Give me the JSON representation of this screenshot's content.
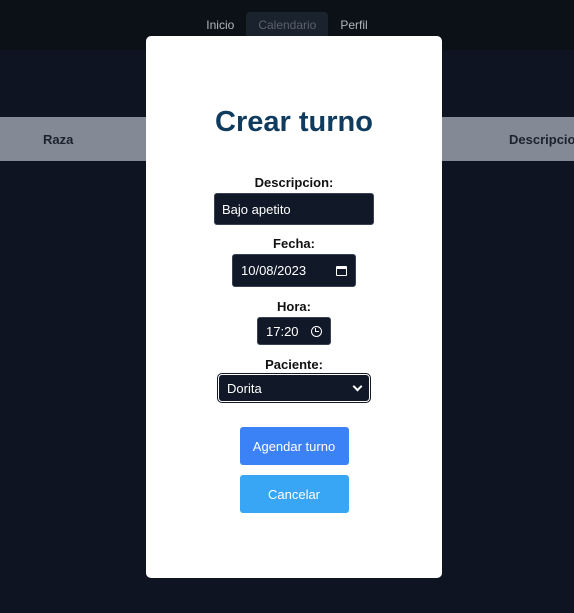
{
  "nav": {
    "items": [
      {
        "label": "Inicio",
        "active": false
      },
      {
        "label": "Calendario",
        "active": true
      },
      {
        "label": "Perfil",
        "active": false
      }
    ]
  },
  "table": {
    "headers": [
      "Raza",
      "Descripcion"
    ]
  },
  "modal": {
    "title": "Crear turno",
    "descripcion": {
      "label": "Descripcion:",
      "value": "Bajo apetito"
    },
    "fecha": {
      "label": "Fecha:",
      "value": "10/08/2023",
      "icon": "calendar-icon"
    },
    "hora": {
      "label": "Hora:",
      "value": "17:20",
      "icon": "clock-icon"
    },
    "paciente": {
      "label": "Paciente:",
      "value": "Dorita",
      "icon": "chevron-down-icon"
    },
    "submit_label": "Agendar turno",
    "cancel_label": "Cancelar"
  },
  "colors": {
    "background": "#111827",
    "title": "#0f3b5f",
    "primary": "#3b82f6",
    "cancel": "#38a6f5"
  }
}
